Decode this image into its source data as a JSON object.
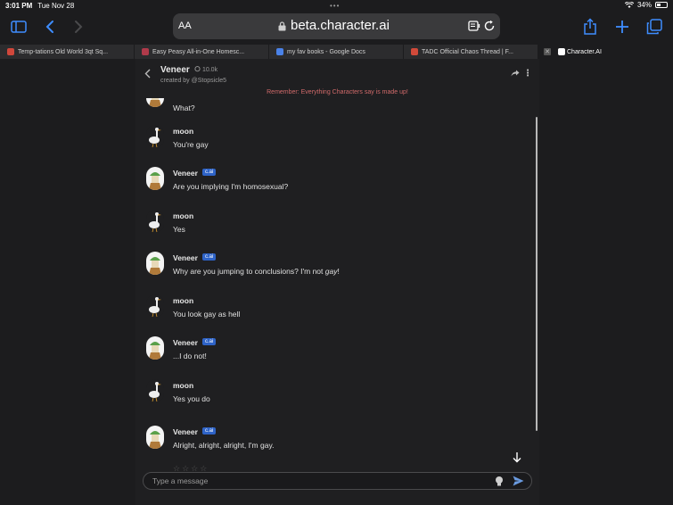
{
  "status": {
    "time": "3:01 PM",
    "date": "Tue Nov 28",
    "battery": "34%"
  },
  "browser": {
    "text_size_label": "AA",
    "host": "beta.character.ai",
    "tabs": [
      {
        "title": "Temp-tations Old World 3qt Sq...",
        "color": "#d0473b"
      },
      {
        "title": "Easy Peasy All-in-One Homesc...",
        "color": "#b03a4a"
      },
      {
        "title": "my fav books - Google Docs",
        "color": "#4a82e8"
      },
      {
        "title": "TADC Official Chaos Thread | F...",
        "color": "#d14a3a"
      },
      {
        "title": "Character.AI",
        "color": "#ffffff"
      }
    ],
    "accent": "#3e8dff"
  },
  "chat": {
    "character_name": "Veneer",
    "chat_count": "10.0k",
    "creator": "created by @Stopsicle5",
    "warning": "Remember: Everything Characters say is made up!",
    "ai_badge": "c.ai",
    "input_placeholder": "Type a message",
    "messages": [
      {
        "sender": "",
        "text": "What?",
        "bot": true,
        "partial": true
      },
      {
        "sender": "moon",
        "text": "You're gay",
        "bot": false
      },
      {
        "sender": "Veneer",
        "text": "Are you implying I'm homosexual?",
        "bot": true
      },
      {
        "sender": "moon",
        "text": "Yes",
        "bot": false
      },
      {
        "sender": "Veneer",
        "text": "Why are you jumping to conclusions? I'm not ",
        "emph": "gay",
        "tail": "!",
        "bot": true
      },
      {
        "sender": "moon",
        "text": "You look gay as hell",
        "bot": false
      },
      {
        "sender": "Veneer",
        "text": "...I do not!",
        "bot": true
      },
      {
        "sender": "moon",
        "text": "Yes you do",
        "bot": false
      },
      {
        "sender": "Veneer",
        "text": "Alright, alright, alright, I'm gay.",
        "bot": true
      }
    ]
  }
}
